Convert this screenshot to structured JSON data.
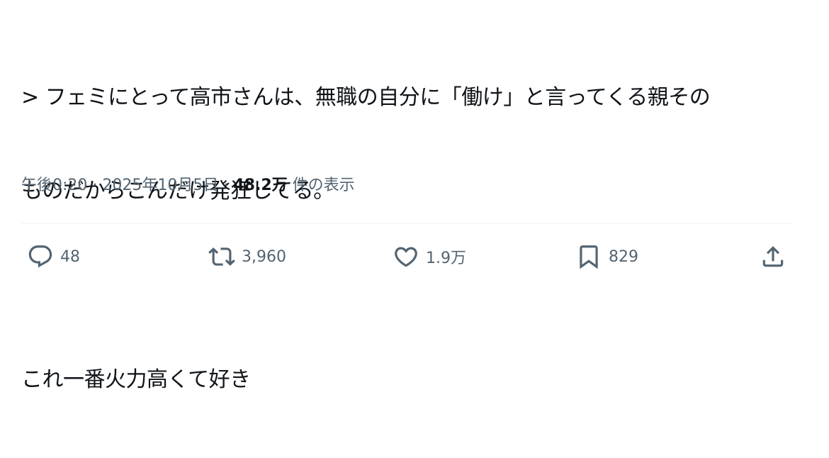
{
  "tweet": {
    "text_lines": [
      "> フェミにとって高市さんは、無職の自分に「働け」と言ってくる親その",
      "ものだからこんだけ発狂してる。",
      "これ一番火力高くて好き"
    ],
    "timestamp": "午後0:20 · 2025年10月5日 · ",
    "views_count": "48.2万",
    "views_label": " 件の表示"
  },
  "actions": {
    "reply": {
      "icon": "reply-icon",
      "count": "48"
    },
    "retweet": {
      "icon": "retweet-icon",
      "count": "3,960"
    },
    "like": {
      "icon": "heart-icon",
      "count": "1.9万"
    },
    "bookmark": {
      "icon": "bookmark-icon",
      "count": "829"
    },
    "share": {
      "icon": "share-icon"
    }
  },
  "colors": {
    "text": "#0f1419",
    "secondary": "#536471",
    "divider": "#eff3f4",
    "background": "#ffffff"
  }
}
